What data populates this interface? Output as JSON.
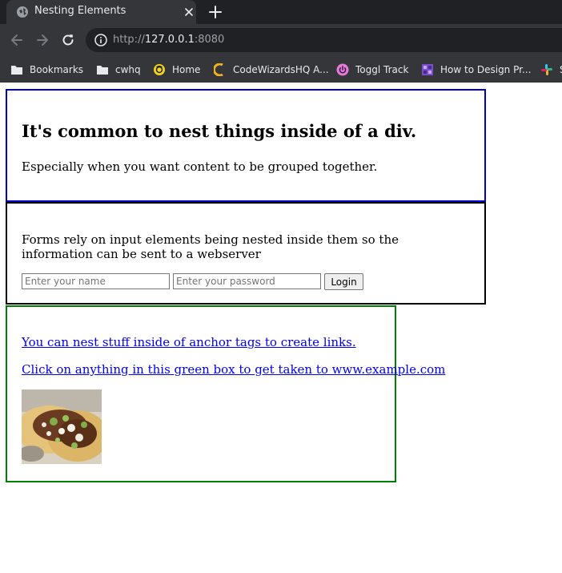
{
  "browser": {
    "tab": {
      "title": "Nesting Elements"
    },
    "address": {
      "scheme": "http://",
      "host": "127.0.0.1",
      "port": ":8080"
    },
    "bookmarks": [
      {
        "label": "Bookmarks",
        "icon": "folder-icon"
      },
      {
        "label": "cwhq",
        "icon": "folder-icon"
      },
      {
        "label": "Home",
        "icon": "home-favicon-icon"
      },
      {
        "label": "CodeWizardsHQ A...",
        "icon": "codewizards-favicon-icon"
      },
      {
        "label": "Toggl Track",
        "icon": "toggl-favicon-icon"
      },
      {
        "label": "How to Design Pr...",
        "icon": "design-favicon-icon"
      },
      {
        "label": "S",
        "icon": "slack-favicon-icon"
      }
    ]
  },
  "page": {
    "section1": {
      "heading": "It's common to nest things inside of a div.",
      "text": "Especially when you want content to be grouped together."
    },
    "section2": {
      "text": "Forms rely on input elements being nested inside them so the information can be sent to a webserver",
      "name_placeholder": "Enter your name",
      "password_placeholder": "Enter your password",
      "login_label": "Login"
    },
    "section3": {
      "link1": "You can nest stuff inside of anchor tags to create links.",
      "link2": "Click on anything in this green box to get taken to www.example.com"
    }
  },
  "colors": {
    "box1_border": "#0000cc",
    "box2_border": "#000000",
    "box3_border": "#008000",
    "link": "#0000ee"
  }
}
